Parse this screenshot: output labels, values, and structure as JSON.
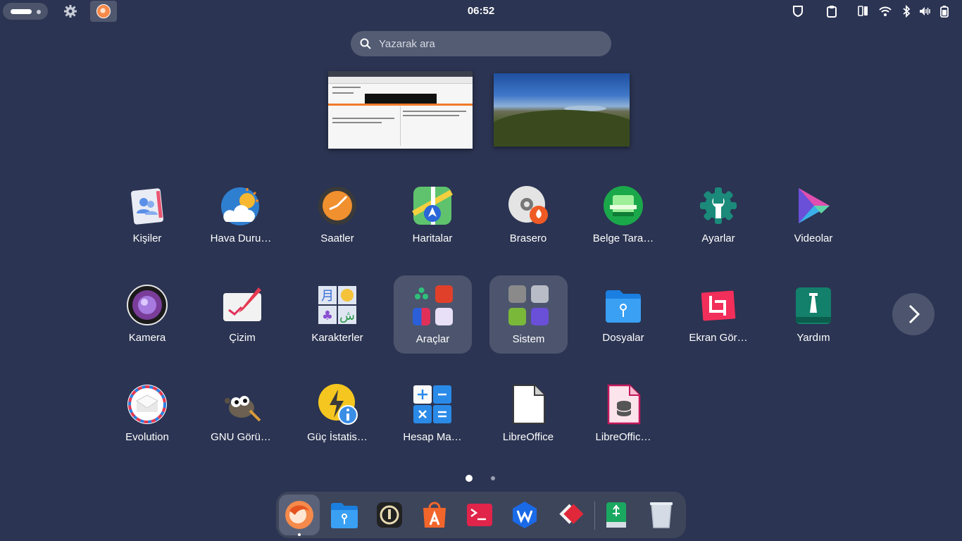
{
  "topbar": {
    "clock": "06:52",
    "tray_icons": [
      "shield-icon",
      "clipboard-icon",
      "device-icon",
      "wifi-icon",
      "bluetooth-icon",
      "volume-icon",
      "battery-icon"
    ]
  },
  "search": {
    "placeholder": "Yazarak ara"
  },
  "apps_row1": [
    {
      "label": "Kişiler",
      "icon": "contacts-icon"
    },
    {
      "label": "Hava Duru…",
      "icon": "weather-icon"
    },
    {
      "label": "Saatler",
      "icon": "clocks-icon"
    },
    {
      "label": "Haritalar",
      "icon": "maps-icon"
    },
    {
      "label": "Brasero",
      "icon": "brasero-icon"
    },
    {
      "label": "Belge Tara…",
      "icon": "document-scanner-icon"
    },
    {
      "label": "Ayarlar",
      "icon": "settings-icon"
    },
    {
      "label": "Videolar",
      "icon": "videos-icon"
    }
  ],
  "apps_row2": [
    {
      "label": "Kamera",
      "icon": "camera-icon"
    },
    {
      "label": "Çizim",
      "icon": "drawing-icon"
    },
    {
      "label": "Karakterler",
      "icon": "characters-icon"
    },
    {
      "label": "Araçlar",
      "icon": "folder-icon"
    },
    {
      "label": "Sistem",
      "icon": "folder-icon"
    },
    {
      "label": "Dosyalar",
      "icon": "files-icon"
    },
    {
      "label": "Ekran Gör…",
      "icon": "screenshot-icon"
    },
    {
      "label": "Yardım",
      "icon": "help-icon"
    }
  ],
  "apps_row3": [
    {
      "label": "Evolution",
      "icon": "evolution-icon"
    },
    {
      "label": "GNU Görü…",
      "icon": "gimp-icon"
    },
    {
      "label": "Güç İstatis…",
      "icon": "power-statistics-icon"
    },
    {
      "label": "Hesap Ma…",
      "icon": "calculator-icon"
    },
    {
      "label": "LibreOffice",
      "icon": "libreoffice-icon"
    },
    {
      "label": "LibreOffic…",
      "icon": "libreoffice-base-icon"
    }
  ],
  "pagination": {
    "pages": 2,
    "current": 1
  },
  "dock": [
    "firefox-icon",
    "files-icon",
    "authenticator-icon",
    "app-center-icon",
    "terminal-icon",
    "wps-icon",
    "anydesk-icon",
    "usb-creator-icon",
    "trash-icon"
  ],
  "colors": {
    "background": "#2b3452",
    "panel": "#4c556d",
    "accent_orange": "#e95420"
  }
}
